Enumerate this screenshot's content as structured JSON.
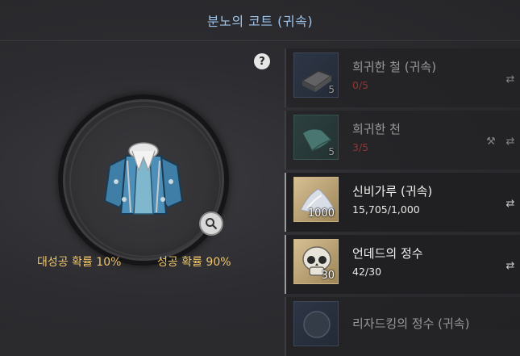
{
  "title": "분노의 코트 (귀속)",
  "help_label": "?",
  "rates": {
    "great_success": "대성공 확률 10%",
    "success": "성공 확률 90%"
  },
  "materials": [
    {
      "name": "희귀한 철 (귀속)",
      "count": "0/5",
      "qty": "5",
      "icon": "iron-ingot-icon"
    },
    {
      "name": "희귀한 천",
      "count": "3/5",
      "qty": "5",
      "icon": "cloth-icon"
    },
    {
      "name": "신비가루 (귀속)",
      "count": "15,705/1,000",
      "qty": "1000",
      "icon": "mystic-powder-icon"
    },
    {
      "name": "언데드의 정수",
      "count": "42/30",
      "qty": "30",
      "icon": "skull-icon"
    },
    {
      "name": "리자드킹의 정수 (귀속)",
      "count": "",
      "qty": "",
      "icon": "lizard-essence-icon"
    }
  ],
  "colors": {
    "title": "#9cc3ea",
    "rate": "#f0c66a",
    "insufficient": "#d94040"
  }
}
